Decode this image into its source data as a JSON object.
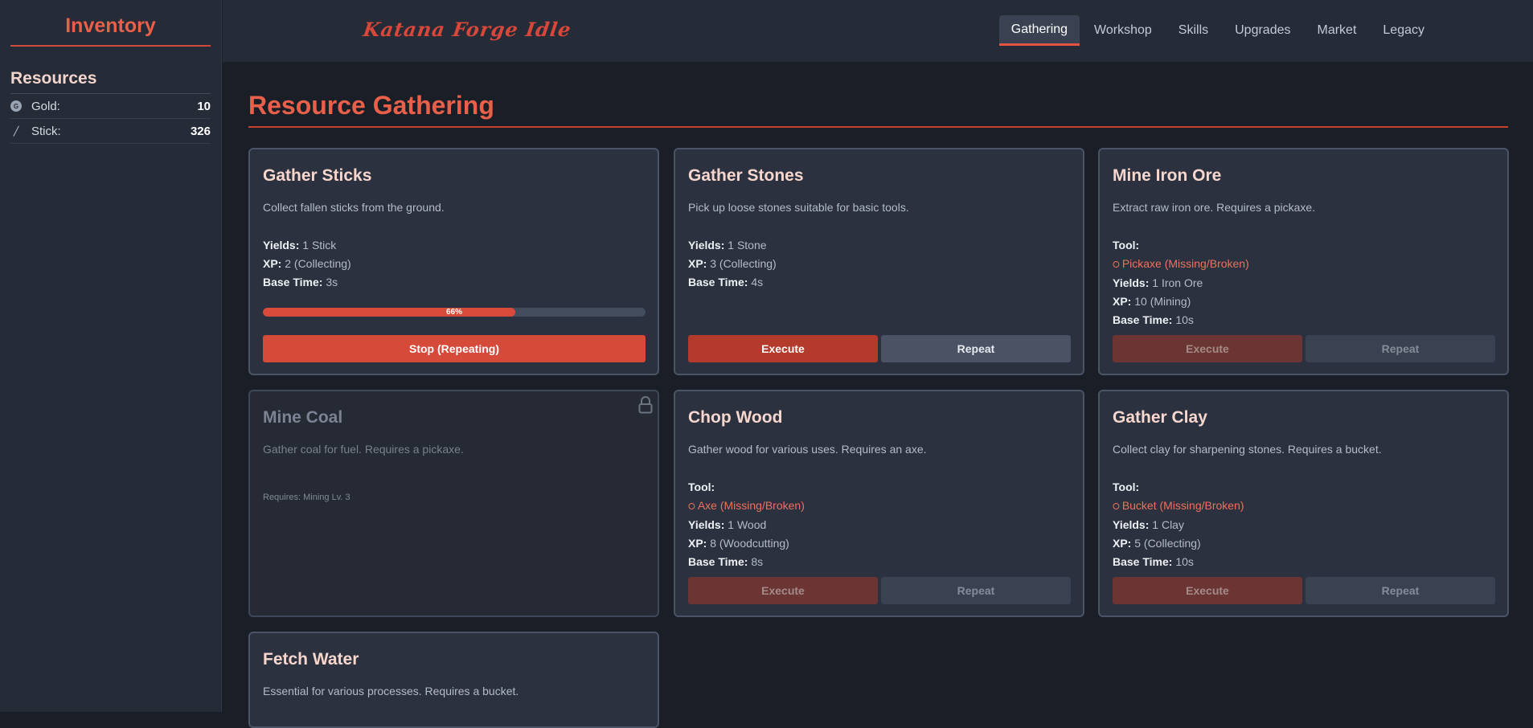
{
  "sidebar": {
    "title": "Inventory",
    "section": "Resources",
    "resources": [
      {
        "icon": "gold-coin-icon",
        "glyph": "G",
        "name": "Gold:",
        "value": "10"
      },
      {
        "icon": "stick-icon",
        "glyph": "╱",
        "name": "Stick:",
        "value": "326"
      }
    ]
  },
  "header": {
    "logo": "Katana Forge Idle",
    "tabs": [
      "Gathering",
      "Workshop",
      "Skills",
      "Upgrades",
      "Market",
      "Legacy"
    ],
    "active_tab": "Gathering"
  },
  "main": {
    "title": "Resource Gathering",
    "labels": {
      "yields": "Yields:",
      "xp": "XP:",
      "base_time": "Base Time:",
      "tool": "Tool:",
      "execute": "Execute",
      "repeat": "Repeat"
    },
    "cards": [
      {
        "title": "Gather Sticks",
        "desc": "Collect fallen sticks from the ground.",
        "yields": "1 Stick",
        "xp": "2 (Collecting)",
        "time": "3s",
        "progress": 66,
        "progress_label": "66%",
        "action": "Stop (Repeating)"
      },
      {
        "title": "Gather Stones",
        "desc": "Pick up loose stones suitable for basic tools.",
        "yields": "1 Stone",
        "xp": "3 (Collecting)",
        "time": "4s"
      },
      {
        "title": "Mine Iron Ore",
        "desc": "Extract raw iron ore. Requires a pickaxe.",
        "tool": "Pickaxe (Missing/Broken)",
        "yields": "1 Iron Ore",
        "xp": "10 (Mining)",
        "time": "10s"
      },
      {
        "title": "Mine Coal",
        "desc": "Gather coal for fuel. Requires a pickaxe.",
        "requires": "Requires: Mining Lv. 3",
        "locked": true
      },
      {
        "title": "Chop Wood",
        "desc": "Gather wood for various uses. Requires an axe.",
        "tool": "Axe (Missing/Broken)",
        "yields": "1 Wood",
        "xp": "8 (Woodcutting)",
        "time": "8s"
      },
      {
        "title": "Gather Clay",
        "desc": "Collect clay for sharpening stones. Requires a bucket.",
        "tool": "Bucket (Missing/Broken)",
        "yields": "1 Clay",
        "xp": "5 (Collecting)",
        "time": "10s"
      },
      {
        "title": "Fetch Water",
        "desc": "Essential for various processes. Requires a bucket."
      }
    ]
  },
  "colors": {
    "accent": "#e8604a",
    "button": "#d54a38",
    "background": "#1a1e27",
    "panel": "#2b313e"
  }
}
